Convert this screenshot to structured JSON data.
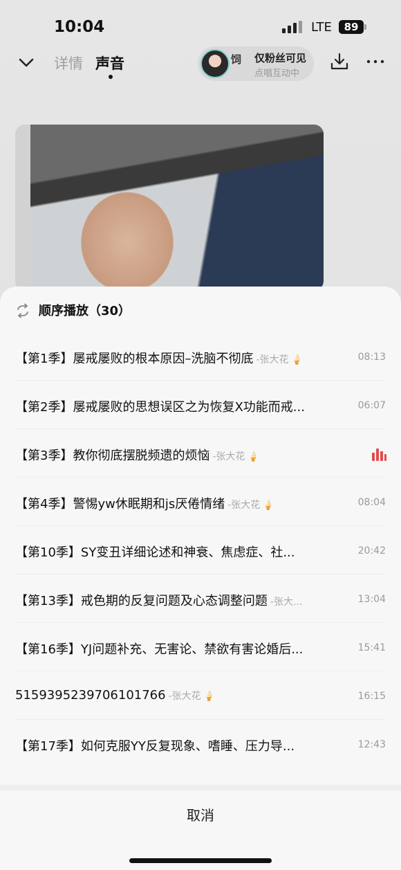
{
  "status_bar": {
    "time": "10:04",
    "network": "LTE",
    "battery": "89"
  },
  "header": {
    "tab_detail": "详情",
    "tab_sound": "声音",
    "live": {
      "frag": "饲",
      "name": "仅粉丝可见",
      "subtitle": "点唱互动中"
    }
  },
  "playlist": {
    "title": "顺序播放（30）",
    "tracks": [
      {
        "title": "【第1季】屡戒屡败的根本原因–洗脑不彻底",
        "author": "-张大花",
        "cone": "🍦",
        "duration": "08:13",
        "playing": false
      },
      {
        "title": "【第2季】屡戒屡败的思想误区之为恢复X功能而戒...",
        "author": "",
        "cone": "",
        "duration": "06:07",
        "playing": false
      },
      {
        "title": "【第3季】教你彻底摆脱频遗的烦恼",
        "author": "-张大花",
        "cone": "🍦",
        "duration": "",
        "playing": true
      },
      {
        "title": "【第4季】警惕yw休眠期和js厌倦情绪",
        "author": "-张大花",
        "cone": "🍦",
        "duration": "08:04",
        "playing": false
      },
      {
        "title": "【第10季】SY变丑详细论述和神衰、焦虑症、社...",
        "author": "",
        "cone": "",
        "duration": "20:42",
        "playing": false
      },
      {
        "title": "【第13季】戒色期的反复问题及心态调整问题",
        "author": "-张大...",
        "cone": "",
        "duration": "13:04",
        "playing": false
      },
      {
        "title": "【第16季】YJ问题补充、无害论、禁欲有害论婚后...",
        "author": "",
        "cone": "",
        "duration": "15:41",
        "playing": false
      },
      {
        "title": "5159395239706101766",
        "author": "-张大花",
        "cone": "🍦",
        "duration": "16:15",
        "playing": false
      },
      {
        "title": "【第17季】如何克服YY反复现象、嗜睡、压力导...",
        "author": "",
        "cone": "",
        "duration": "12:43",
        "playing": false
      }
    ]
  },
  "cancel_label": "取消"
}
